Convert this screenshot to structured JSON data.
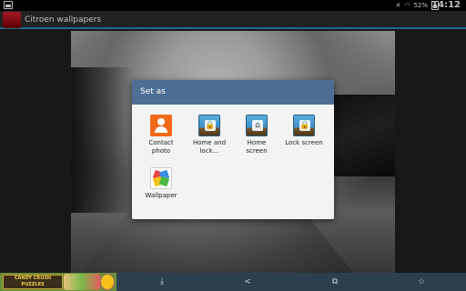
{
  "status_bar": {
    "battery": "52%",
    "time": "14:12"
  },
  "app_bar": {
    "title": "Citroen wallpapers"
  },
  "dialog": {
    "title": "Set as",
    "options": [
      {
        "label": "Contact\nphoto",
        "icon": "contact-photo-icon"
      },
      {
        "label": "Home and\nlock...",
        "icon": "home-and-lock-icon"
      },
      {
        "label": "Home\nscreen",
        "icon": "home-screen-icon"
      },
      {
        "label": "Lock screen",
        "icon": "lock-screen-icon"
      },
      {
        "label": "Wallpaper",
        "icon": "wallpaper-icon"
      }
    ]
  },
  "ad": {
    "text": "CANDY CRUSH\nPUZZLES"
  },
  "bottom_bar": {
    "download_icon": "download-icon",
    "share_icon": "share-icon",
    "crop_icon": "crop-icon",
    "favorite_icon": "star-icon"
  }
}
